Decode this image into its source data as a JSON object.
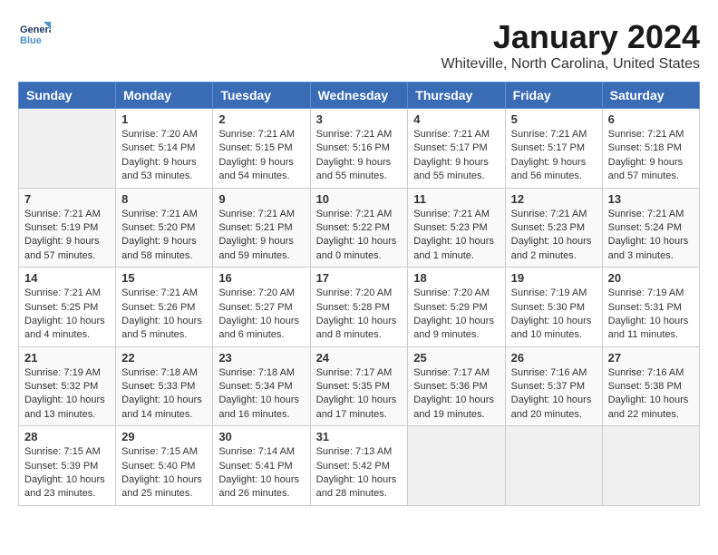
{
  "logo": {
    "line1": "General",
    "line2": "Blue"
  },
  "title": "January 2024",
  "location": "Whiteville, North Carolina, United States",
  "days_of_week": [
    "Sunday",
    "Monday",
    "Tuesday",
    "Wednesday",
    "Thursday",
    "Friday",
    "Saturday"
  ],
  "weeks": [
    [
      {
        "day": "",
        "info": ""
      },
      {
        "day": "1",
        "info": "Sunrise: 7:20 AM\nSunset: 5:14 PM\nDaylight: 9 hours\nand 53 minutes."
      },
      {
        "day": "2",
        "info": "Sunrise: 7:21 AM\nSunset: 5:15 PM\nDaylight: 9 hours\nand 54 minutes."
      },
      {
        "day": "3",
        "info": "Sunrise: 7:21 AM\nSunset: 5:16 PM\nDaylight: 9 hours\nand 55 minutes."
      },
      {
        "day": "4",
        "info": "Sunrise: 7:21 AM\nSunset: 5:17 PM\nDaylight: 9 hours\nand 55 minutes."
      },
      {
        "day": "5",
        "info": "Sunrise: 7:21 AM\nSunset: 5:17 PM\nDaylight: 9 hours\nand 56 minutes."
      },
      {
        "day": "6",
        "info": "Sunrise: 7:21 AM\nSunset: 5:18 PM\nDaylight: 9 hours\nand 57 minutes."
      }
    ],
    [
      {
        "day": "7",
        "info": "Sunrise: 7:21 AM\nSunset: 5:19 PM\nDaylight: 9 hours\nand 57 minutes."
      },
      {
        "day": "8",
        "info": "Sunrise: 7:21 AM\nSunset: 5:20 PM\nDaylight: 9 hours\nand 58 minutes."
      },
      {
        "day": "9",
        "info": "Sunrise: 7:21 AM\nSunset: 5:21 PM\nDaylight: 9 hours\nand 59 minutes."
      },
      {
        "day": "10",
        "info": "Sunrise: 7:21 AM\nSunset: 5:22 PM\nDaylight: 10 hours\nand 0 minutes."
      },
      {
        "day": "11",
        "info": "Sunrise: 7:21 AM\nSunset: 5:23 PM\nDaylight: 10 hours\nand 1 minute."
      },
      {
        "day": "12",
        "info": "Sunrise: 7:21 AM\nSunset: 5:23 PM\nDaylight: 10 hours\nand 2 minutes."
      },
      {
        "day": "13",
        "info": "Sunrise: 7:21 AM\nSunset: 5:24 PM\nDaylight: 10 hours\nand 3 minutes."
      }
    ],
    [
      {
        "day": "14",
        "info": "Sunrise: 7:21 AM\nSunset: 5:25 PM\nDaylight: 10 hours\nand 4 minutes."
      },
      {
        "day": "15",
        "info": "Sunrise: 7:21 AM\nSunset: 5:26 PM\nDaylight: 10 hours\nand 5 minutes."
      },
      {
        "day": "16",
        "info": "Sunrise: 7:20 AM\nSunset: 5:27 PM\nDaylight: 10 hours\nand 6 minutes."
      },
      {
        "day": "17",
        "info": "Sunrise: 7:20 AM\nSunset: 5:28 PM\nDaylight: 10 hours\nand 8 minutes."
      },
      {
        "day": "18",
        "info": "Sunrise: 7:20 AM\nSunset: 5:29 PM\nDaylight: 10 hours\nand 9 minutes."
      },
      {
        "day": "19",
        "info": "Sunrise: 7:19 AM\nSunset: 5:30 PM\nDaylight: 10 hours\nand 10 minutes."
      },
      {
        "day": "20",
        "info": "Sunrise: 7:19 AM\nSunset: 5:31 PM\nDaylight: 10 hours\nand 11 minutes."
      }
    ],
    [
      {
        "day": "21",
        "info": "Sunrise: 7:19 AM\nSunset: 5:32 PM\nDaylight: 10 hours\nand 13 minutes."
      },
      {
        "day": "22",
        "info": "Sunrise: 7:18 AM\nSunset: 5:33 PM\nDaylight: 10 hours\nand 14 minutes."
      },
      {
        "day": "23",
        "info": "Sunrise: 7:18 AM\nSunset: 5:34 PM\nDaylight: 10 hours\nand 16 minutes."
      },
      {
        "day": "24",
        "info": "Sunrise: 7:17 AM\nSunset: 5:35 PM\nDaylight: 10 hours\nand 17 minutes."
      },
      {
        "day": "25",
        "info": "Sunrise: 7:17 AM\nSunset: 5:36 PM\nDaylight: 10 hours\nand 19 minutes."
      },
      {
        "day": "26",
        "info": "Sunrise: 7:16 AM\nSunset: 5:37 PM\nDaylight: 10 hours\nand 20 minutes."
      },
      {
        "day": "27",
        "info": "Sunrise: 7:16 AM\nSunset: 5:38 PM\nDaylight: 10 hours\nand 22 minutes."
      }
    ],
    [
      {
        "day": "28",
        "info": "Sunrise: 7:15 AM\nSunset: 5:39 PM\nDaylight: 10 hours\nand 23 minutes."
      },
      {
        "day": "29",
        "info": "Sunrise: 7:15 AM\nSunset: 5:40 PM\nDaylight: 10 hours\nand 25 minutes."
      },
      {
        "day": "30",
        "info": "Sunrise: 7:14 AM\nSunset: 5:41 PM\nDaylight: 10 hours\nand 26 minutes."
      },
      {
        "day": "31",
        "info": "Sunrise: 7:13 AM\nSunset: 5:42 PM\nDaylight: 10 hours\nand 28 minutes."
      },
      {
        "day": "",
        "info": ""
      },
      {
        "day": "",
        "info": ""
      },
      {
        "day": "",
        "info": ""
      }
    ]
  ]
}
